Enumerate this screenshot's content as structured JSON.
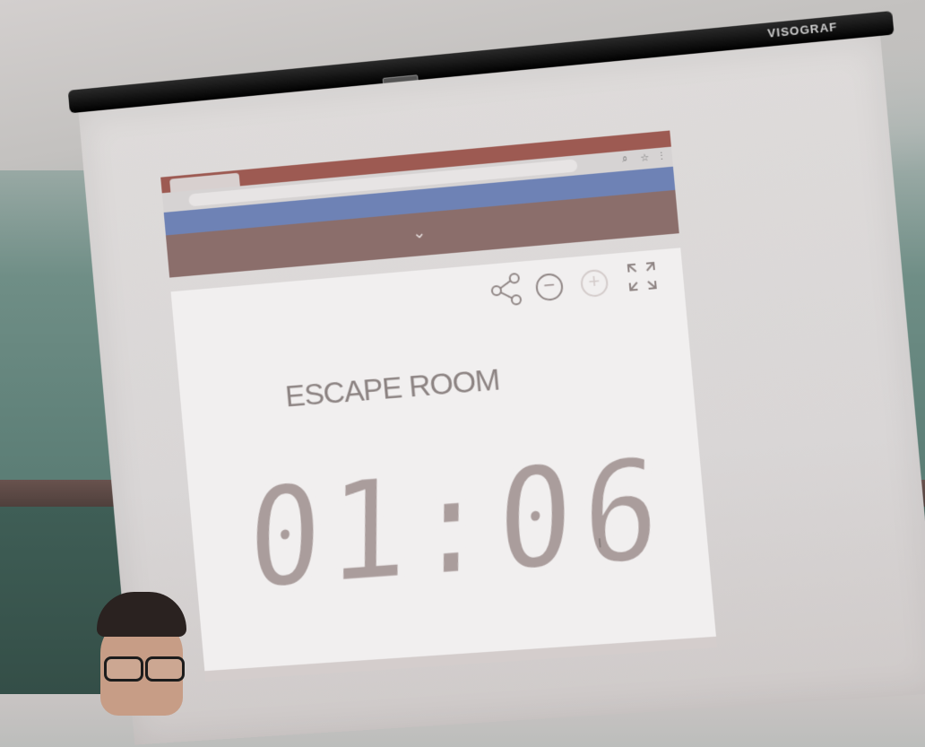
{
  "projector_screen": {
    "brand": "VISOGRAF"
  },
  "projected_page": {
    "title": "ESCAPE ROOM",
    "timer": "01:06",
    "controls": [
      {
        "name": "share-icon",
        "glyph": "⟨⟩"
      },
      {
        "name": "minus-icon",
        "glyph": "−"
      },
      {
        "name": "plus-icon",
        "glyph": "+"
      },
      {
        "name": "fullscreen-icon",
        "glyph": "⤢"
      }
    ],
    "cursor_glyph": "I"
  },
  "colors": {
    "accent_blue": "#6e82b5",
    "tab_bar": "#9d5a52",
    "timer_digits": "#aa9d9c"
  }
}
